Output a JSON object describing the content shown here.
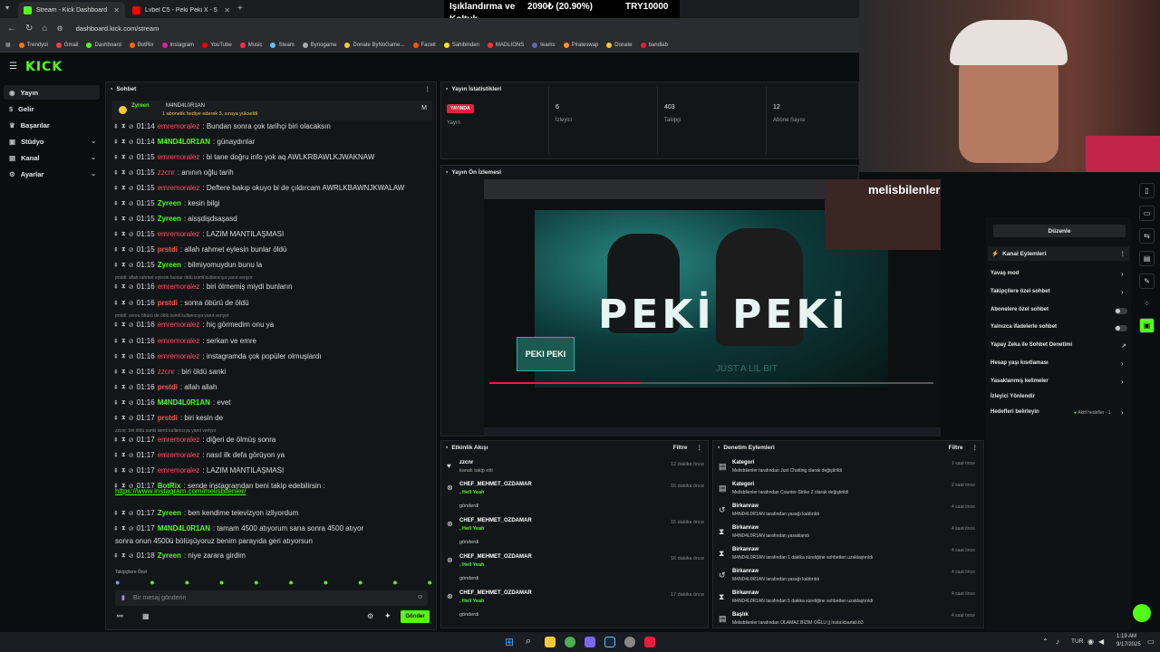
{
  "browser": {
    "tabs": [
      {
        "label": "Stream - Kick Dashboard",
        "active": true
      },
      {
        "label": "Lvbel C5 - Peki Peki X - 50 Cent",
        "active": false
      }
    ],
    "url": "dashboard.kick.com/stream",
    "bookmarks": [
      "Trendyol",
      "Gmail",
      "Dashboard",
      "BotRix",
      "Instagram",
      "YouTube",
      "Music",
      "Steam",
      "Bynogame",
      "Donate ByNoGame...",
      "Faceit",
      "Sahibinden",
      "MADLIONS",
      "teams",
      "Pirateswap",
      "Donate",
      "bandlab"
    ]
  },
  "ticker": {
    "title": "Işıklandırma ve",
    "subtitle": "Koltuk",
    "progress": "2090₺ (20.90%)",
    "goal": "TRY10000"
  },
  "logo": "KICK",
  "sidebar": [
    {
      "label": "Yayın",
      "chev": false
    },
    {
      "label": "Gelir",
      "chev": false
    },
    {
      "label": "Başarılar",
      "chev": false
    },
    {
      "label": "Stüdyo",
      "chev": true
    },
    {
      "label": "Kanal",
      "chev": true
    },
    {
      "label": "Ayarlar",
      "chev": true
    }
  ],
  "chat": {
    "title": "Sohbet",
    "pinned_user": "Zyreen",
    "pinned_user2": "M4ND4L0R1AN",
    "pinned_text": "1 abonelik hediye ederek 3. sıraya yükseldi",
    "messages": [
      {
        "time": "01:14",
        "user": "emremoralez",
        "cls": "u-pink",
        "text": "Bundan sonra çok tarihçi biri olacaksın"
      },
      {
        "time": "01:14",
        "user": "M4ND4L0R1AN",
        "cls": "u-green",
        "text": "günaydınlar"
      },
      {
        "time": "01:15",
        "user": "emremoralez",
        "cls": "u-pink",
        "text": "bi tane doğru info yok aq AWLKRBAWLKJWAKNAW"
      },
      {
        "time": "01:15",
        "user": "zzcnr",
        "cls": "u-pink",
        "text": "anının oğlu tarih"
      },
      {
        "time": "01:15",
        "user": "emremoralez",
        "cls": "u-pink",
        "text": "Deftere bakıp okuyo bi de çıldırcam AWRLKBAWNJKWALAW"
      },
      {
        "time": "01:15",
        "user": "Zyreen",
        "cls": "u-green",
        "text": "kesin bilgi"
      },
      {
        "time": "01:15",
        "user": "Zyreen",
        "cls": "u-green",
        "text": "aisşdişdsaşasd"
      },
      {
        "time": "01:15",
        "user": "emremoralez",
        "cls": "u-pink",
        "text": "LAZIM MANTILAŞMASI"
      },
      {
        "time": "01:15",
        "user": "prstdi",
        "cls": "u-red",
        "text": "allah rahmet eylesin bunlar öldü"
      },
      {
        "time": "01:15",
        "user": "Zyreen",
        "cls": "u-green",
        "text": "bilmiyomuydun bunu la"
      },
      {
        "time": "01:16",
        "user": "emremoralez",
        "cls": "u-pink",
        "text": "biri ölmemiş miydi bunların"
      },
      {
        "time": "01:16",
        "user": "prstdi",
        "cls": "u-red",
        "text": "sonra öbürü de öldü"
      },
      {
        "time": "01:16",
        "user": "emremoralez",
        "cls": "u-pink",
        "text": "hiç görmedim onu ya"
      },
      {
        "time": "01:16",
        "user": "emremoralez",
        "cls": "u-pink",
        "text": "serkan ve emre"
      },
      {
        "time": "01:16",
        "user": "emremoralez",
        "cls": "u-pink",
        "text": "instagramda çok popüler olmuşlardı"
      },
      {
        "time": "01:16",
        "user": "zzcnr",
        "cls": "u-pink",
        "text": "biri öldü sanki"
      },
      {
        "time": "01:16",
        "user": "prstdi",
        "cls": "u-red",
        "text": "allah allah"
      },
      {
        "time": "01:16",
        "user": "M4ND4L0R1AN",
        "cls": "u-green",
        "text": "evet"
      },
      {
        "time": "01:17",
        "user": "prstdi",
        "cls": "u-red",
        "text": "biri kesin de"
      },
      {
        "time": "01:17",
        "user": "emremoralez",
        "cls": "u-pink",
        "text": "diğeri de ölmüş sonra"
      },
      {
        "time": "01:17",
        "user": "emremoralez",
        "cls": "u-pink",
        "text": "nasıl ilk defa görüyon ya"
      },
      {
        "time": "01:17",
        "user": "emremoralez",
        "cls": "u-pink",
        "text": "LAZIM MANTILAŞMASI"
      },
      {
        "time": "01:17",
        "user": "BotRix",
        "cls": "u-green",
        "text": "sende instagramdan beni takip edebilirsin :"
      },
      {
        "time": "01:17",
        "user": "Zyreen",
        "cls": "u-green",
        "text": "ben kendime televizyon izliyordum"
      },
      {
        "time": "01:17",
        "user": "M4ND4L0R1AN",
        "cls": "u-green",
        "text": "tamam 4500 atıyorum sana sonra 4500 atıyor"
      },
      {
        "time": "01:18",
        "user": "Zyreen",
        "cls": "u-green",
        "text": "niye zarara girdim"
      }
    ],
    "botrix_link": "https://www.instagram.com/melisbilenler/",
    "wrap_text": "sonra onun 4500ü bölüşüyoruz benim parayıda geri atıyorsun",
    "sys1": "prstdi: allah rahmet eylesin bunlar öldü isimli kullanıcıya yanıt veriyor",
    "sys2": "prstdi: sonra öbürü de öldü isimli kullanıcıya yanıt veriyor",
    "sys3": "zzcnr: biri öldü sanki isimli kullanıcıya yanıt veriyor",
    "followers_only": "Takipçilere Özel",
    "input_placeholder": "Bir mesaj gönderin",
    "send_label": "Gönder"
  },
  "stats": {
    "title": "Yayın İstatistikleri",
    "live": "YAYINDA",
    "items": [
      {
        "value": "",
        "label": "Yayın"
      },
      {
        "value": "6",
        "label": "İzleyici"
      },
      {
        "value": "403",
        "label": "Takipçi"
      },
      {
        "value": "12",
        "label": "Abone Sayısı"
      }
    ]
  },
  "preview": {
    "title": "Yayın Ön İzlemesi",
    "video_text": "PEKİ PEKİ",
    "thumb_text": "PEKI PEKI",
    "overlay_name": "melisbilenler",
    "sub_text": "JUST A LIL BIT"
  },
  "activity": {
    "title": "Etkinlik Akışı",
    "filter": "Filtre",
    "items": [
      {
        "user": "zzcnr",
        "text": "kanalı takip etti",
        "time": "12 dakika önce"
      },
      {
        "user": "CHEF_MEHMET_OZDAMAR",
        "text": ", Hell Yeah",
        "sub": "gönderdi",
        "time": "16 dakika önce"
      },
      {
        "user": "CHEF_MEHMET_OZDAMAR",
        "text": ", Hell Yeah",
        "sub": "gönderdi",
        "time": "16 dakika önce"
      },
      {
        "user": "CHEF_MEHMET_OZDAMAR",
        "text": ", Hell Yeah",
        "sub": "gönderdi",
        "time": "16 dakika önce"
      },
      {
        "user": "CHEF_MEHMET_OZDAMAR",
        "text": ", Hell Yeah",
        "sub": "gönderdi",
        "time": "17 dakika önce"
      }
    ]
  },
  "moderation": {
    "title": "Denetim Eylemleri",
    "filter": "Filtre",
    "items": [
      {
        "head": "Kategori",
        "line": "Melisbilenler tarafından Just Chatting olarak değiştirildi",
        "time": "1 saat önce"
      },
      {
        "head": "Kategori",
        "line": "Melisbilenler tarafından Counter-Strike 2 olarak değiştirildi",
        "time": "2 saat önce"
      },
      {
        "head": "Birkanraw",
        "line": "M4ND4L0R1AN tarafından yasağı kaldırıldı",
        "time": "4 saat önce"
      },
      {
        "head": "Birkanraw",
        "line": "M4ND4L0R1AN tarafından yasaklandı",
        "time": "4 saat önce"
      },
      {
        "head": "Birkanraw",
        "line": "M4ND4L0R1AN tarafından 1 dakika süreliğine sohbetten uzaklaştırıldı",
        "time": "4 saat önce"
      },
      {
        "head": "Birkanraw",
        "line": "M4ND4L0R1AN tarafından yasağı kaldırıldı",
        "time": "4 saat önce"
      },
      {
        "head": "Birkanraw",
        "line": "M4ND4L0R1AN tarafından 5 dakika süreliğine sohbetten uzaklaştırıldı",
        "time": "4 saat önce"
      },
      {
        "head": "Başlık",
        "line": "Melisbilenler tarafından OLAMAZ BİZİM OĞLU || İnsta:kbartali.b3",
        "time": "4 saat önce"
      }
    ]
  },
  "channel_actions": {
    "edit": "Düzenle",
    "title": "Kanal Eylemleri",
    "items": [
      {
        "label": "Yavaş mod",
        "kind": "chev"
      },
      {
        "label": "Takipçilere özel sohbet",
        "kind": "chev"
      },
      {
        "label": "Abonelere özel sohbet",
        "kind": "toggle"
      },
      {
        "label": "Yalnızca ifadelerle sohbet",
        "kind": "toggle"
      },
      {
        "label": "Yapay Zeka ile Sohbet Denetimi",
        "kind": "ext"
      },
      {
        "label": "Hesap yaşı kısıtlaması",
        "kind": "chev"
      },
      {
        "label": "Yasaklanmış kelimeler",
        "kind": "chev"
      },
      {
        "label": "İzleyici Yönlendir",
        "kind": "none"
      },
      {
        "label": "Hedefleri belirleyin",
        "kind": "goal"
      }
    ],
    "goal_text": "Aktif hedefler - 1"
  },
  "taskbar": {
    "lang": "TUR",
    "time": "1:19 AM",
    "date": "9/17/2025"
  },
  "colors": {
    "kick_green": "#53fc18",
    "live_red": "#e4203c"
  }
}
